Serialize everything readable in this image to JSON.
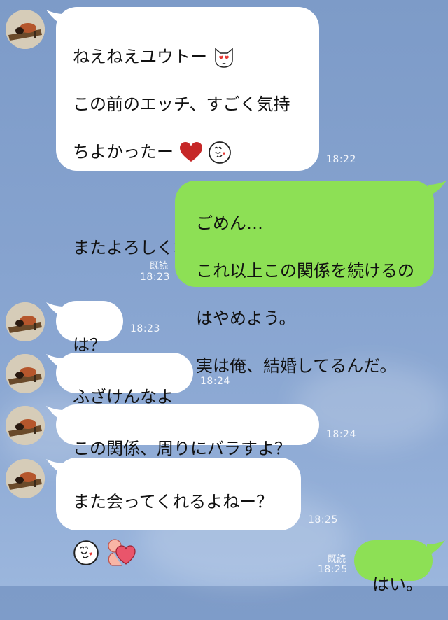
{
  "messages": [
    {
      "side": "in",
      "lines": [
        "ねえねえユウトー",
        "この前のエッチ、すごく気持",
        "ちよかったー",
        "",
        "またよろしくね"
      ],
      "time": "18:22"
    },
    {
      "side": "out",
      "lines": [
        "ごめん…",
        "これ以上この関係を続けるの",
        "はやめよう。",
        "実は俺、結婚してるんだ。"
      ],
      "time": "18:23",
      "read": "既読"
    },
    {
      "side": "in",
      "lines": [
        "は？"
      ],
      "time": "18:23"
    },
    {
      "side": "in",
      "lines": [
        "ふざけんなよ"
      ],
      "time": "18:24"
    },
    {
      "side": "in",
      "lines": [
        "この関係、周りにバラすよ？"
      ],
      "time": "18:24"
    },
    {
      "side": "in",
      "lines": [
        "また会ってくれるよねー？"
      ],
      "time": "18:25"
    },
    {
      "side": "out",
      "lines": [
        "はい。"
      ],
      "time": "18:25",
      "read": "既読"
    }
  ],
  "icons": {
    "cat_heart_eyes": "cat-heart-eyes-icon",
    "red_heart": "red-heart-icon",
    "stamp_sticker": "stamp-sticker-icon",
    "blush_face": "blushing-face-icon",
    "thumbs_up": "thumbs-up-icon",
    "hug_heart": "hugging-heart-sticker-icon"
  },
  "colors": {
    "incoming": "#ffffff",
    "outgoing": "#8de055",
    "background": "#85a2ce"
  }
}
